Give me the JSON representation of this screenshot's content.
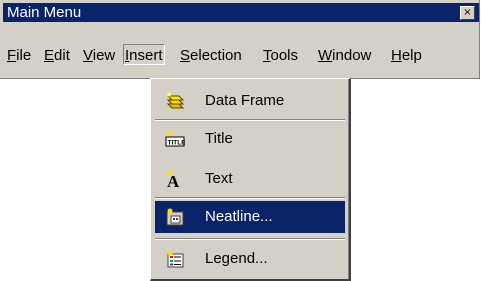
{
  "window": {
    "title": "Main Menu",
    "close_glyph": "×"
  },
  "menubar": {
    "items": [
      {
        "label": "File",
        "mnemonic": "F"
      },
      {
        "label": "Edit",
        "mnemonic": "E"
      },
      {
        "label": "View",
        "mnemonic": "V"
      },
      {
        "label": "Insert",
        "mnemonic": "I"
      },
      {
        "label": "Selection",
        "mnemonic": "S"
      },
      {
        "label": "Tools",
        "mnemonic": "T"
      },
      {
        "label": "Window",
        "mnemonic": "W"
      },
      {
        "label": "Help",
        "mnemonic": "H"
      }
    ],
    "open_menu": "Insert"
  },
  "insert_menu": {
    "items": [
      {
        "label": "Data Frame",
        "icon": "data-frame-icon"
      },
      {
        "label": "Title",
        "icon": "title-icon"
      },
      {
        "label": "Text",
        "icon": "text-icon"
      },
      {
        "label": "Neatline...",
        "icon": "neatline-icon",
        "selected": true
      },
      {
        "label": "Legend...",
        "icon": "legend-icon"
      }
    ]
  },
  "colors": {
    "titlebar": "#0a246a",
    "selection": "#0a246a",
    "face": "#d4d0c8"
  }
}
